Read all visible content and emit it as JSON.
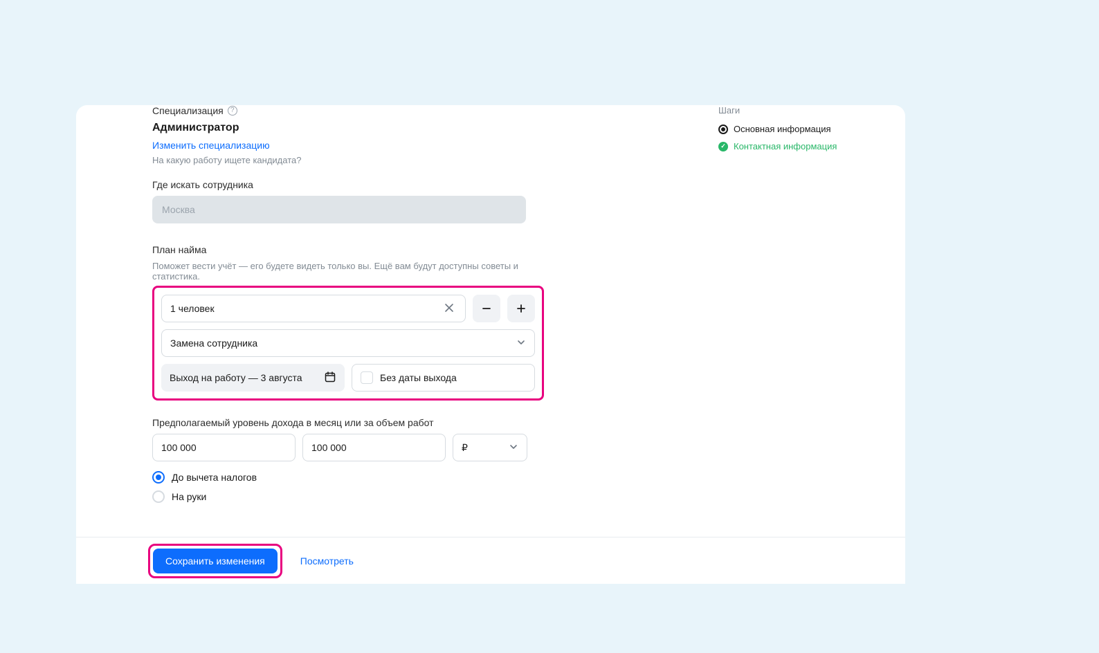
{
  "specialization": {
    "label": "Специализация",
    "name": "Администратор",
    "change_link": "Изменить специализацию",
    "hint": "На какую работу ищете кандидата?"
  },
  "location": {
    "label": "Где искать сотрудника",
    "value": "Москва"
  },
  "hiring_plan": {
    "label": "План найма",
    "hint": "Поможет вести учёт — его будете видеть только вы. Ещё вам будут доступны советы и статистика.",
    "count_value": "1 человек",
    "reason_value": "Замена сотрудника",
    "start_date": "Выход на работу — 3 августа",
    "no_date_label": "Без даты выхода"
  },
  "income": {
    "label": "Предполагаемый уровень дохода в месяц или за объем работ",
    "from": "100 000",
    "to": "100 000",
    "currency": "₽",
    "tax_option_before": "До вычета налогов",
    "tax_option_net": "На руки"
  },
  "actions": {
    "save": "Сохранить изменения",
    "preview": "Посмотреть"
  },
  "steps": {
    "title": "Шаги",
    "items": [
      {
        "label": "Основная информация",
        "status": "current"
      },
      {
        "label": "Контактная информация",
        "status": "done"
      }
    ]
  }
}
